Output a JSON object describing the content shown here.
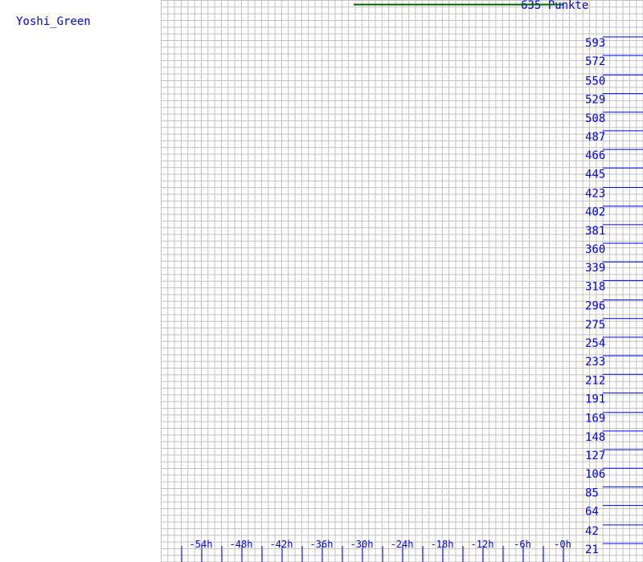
{
  "player_name": "Yoshi_Green",
  "chart_data": {
    "type": "line",
    "title": "635 Punkte",
    "y_ticks": [
      593,
      572,
      550,
      529,
      508,
      487,
      466,
      445,
      423,
      402,
      381,
      360,
      339,
      318,
      296,
      275,
      254,
      233,
      212,
      191,
      169,
      148,
      127,
      106,
      85,
      64,
      42,
      21
    ],
    "x_ticks": [
      "-54h",
      "-48h",
      "-42h",
      "-36h",
      "-30h",
      "-24h",
      "-18h",
      "-12h",
      "-6h",
      "-0h"
    ],
    "x_tick_hours": [
      -54,
      -48,
      -42,
      -36,
      -30,
      -24,
      -18,
      -12,
      -6,
      0
    ],
    "grid": true,
    "series": [
      {
        "color": "#006400",
        "x": [
          -31.2,
          0
        ],
        "y": [
          635,
          635
        ]
      }
    ],
    "colors": {
      "axis": "#0000ff",
      "grid": "#c0c0c0",
      "line": "#006400"
    }
  }
}
